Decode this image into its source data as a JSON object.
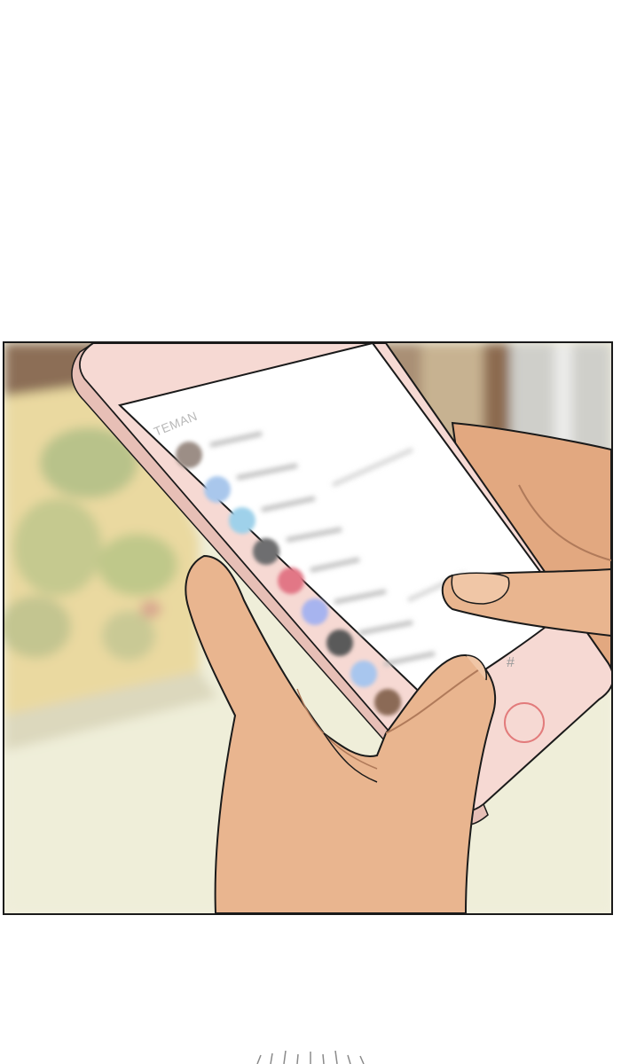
{
  "panel": {
    "screen_header": "TEMAN",
    "keypad_symbol": "#"
  },
  "colors": {
    "phone_body": "#f6d9d3",
    "skin": "#e9b58f",
    "skin_shadow": "#c98a68",
    "screen": "#ffffff",
    "background_wall": "#efeed9"
  },
  "contacts": [
    {
      "avatar_color": "#9c8e86"
    },
    {
      "avatar_color": "#a9c7ec"
    },
    {
      "avatar_color": "#9fd1ea"
    },
    {
      "avatar_color": "#6e6e70"
    },
    {
      "avatar_color": "#e27786"
    },
    {
      "avatar_color": "#a7b4ef"
    },
    {
      "avatar_color": "#5a5a5a"
    },
    {
      "avatar_color": "#a8c6ee"
    },
    {
      "avatar_color": "#8b6a56"
    }
  ]
}
